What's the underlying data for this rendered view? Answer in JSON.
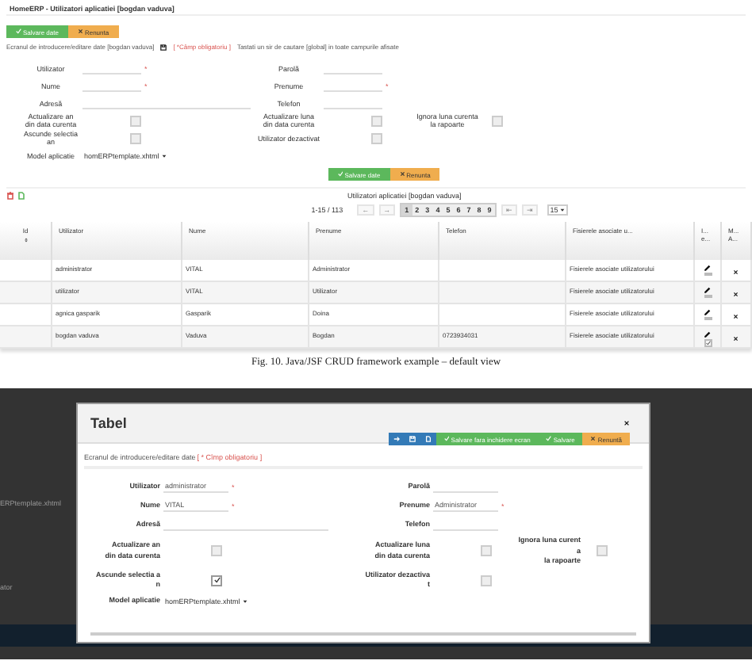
{
  "default_view": {
    "title": "HomeERP - Utilizatori aplicatiei [bogdan vaduva]",
    "top_buttons": [
      {
        "kind": "save",
        "label": "Salvare date"
      },
      {
        "kind": "cancel",
        "label": "Renunta"
      }
    ],
    "form_note": {
      "text": "Ecranul de introducere/editare date [bogdan vaduva]",
      "required_note": "[ *Câmp obligatoriu ]",
      "search_hint": "Tastati un sir de cautare [global] in toate campurile afisate"
    },
    "form_rows": [
      {
        "left": {
          "kind": "text",
          "label": [
            "Utilizator"
          ],
          "mark": "*"
        },
        "middle": {
          "kind": "text",
          "label": [
            "Parolă"
          ]
        }
      },
      {
        "left": {
          "kind": "text",
          "label": [
            "Nume"
          ],
          "mark": "*"
        },
        "middle": {
          "kind": "text",
          "label": [
            "Prenume"
          ],
          "mark": "*"
        }
      },
      {
        "left": {
          "kind": "wide",
          "label": [
            "Adresă"
          ]
        },
        "middle": {
          "kind": "text",
          "label": [
            "Telefon"
          ]
        }
      },
      {
        "left": {
          "kind": "check",
          "label": [
            "Actualizare an",
            "din data curenta"
          ],
          "checked": false
        },
        "middle": {
          "kind": "check",
          "label": [
            "Actualizare luna",
            "din data curenta"
          ],
          "checked": false
        },
        "right": {
          "kind": "check",
          "label": [
            "Ignora luna curenta",
            "la rapoarte"
          ],
          "checked": false
        }
      },
      {
        "left": {
          "kind": "check",
          "label": [
            "Ascunde selectia an"
          ],
          "checked": false
        },
        "middle": {
          "kind": "check",
          "label": [
            "Utilizator dezactivat"
          ],
          "checked": false
        }
      },
      {
        "left": {
          "kind": "select",
          "label": [
            "Model aplicatie"
          ],
          "value": "homERPtemplate.xhtml"
        }
      }
    ],
    "bottom_buttons": [
      {
        "kind": "save",
        "label": "Salvare date"
      },
      {
        "kind": "cancel",
        "label": "Renunta"
      }
    ],
    "table_title": "Utilizatori aplicatiei [bogdan vaduva]",
    "pager": {
      "range": "1-15 / 113",
      "prev": [
        "←",
        "→"
      ],
      "next": [
        "⇤",
        "⇥"
      ],
      "page_size": "15",
      "pages": [
        {
          "label": "1",
          "selected": true
        },
        {
          "label": "2",
          "selected": false
        },
        {
          "label": "3",
          "selected": false
        },
        {
          "label": "4",
          "selected": false
        },
        {
          "label": "5",
          "selected": false
        },
        {
          "label": "6",
          "selected": false
        },
        {
          "label": "7",
          "selected": false
        },
        {
          "label": "8",
          "selected": false
        },
        {
          "label": "9",
          "selected": false
        }
      ]
    },
    "columns": [
      {
        "label": [
          "Id"
        ],
        "sortable": true
      },
      {
        "label": [
          "Utilizator"
        ]
      },
      {
        "label": [
          "Nume"
        ]
      },
      {
        "label": [
          "Prenume"
        ]
      },
      {
        "label": [
          "Telefon"
        ]
      },
      {
        "label": [
          "Fisierele asociate u..."
        ]
      },
      {
        "label": [
          "I...",
          "e..."
        ]
      },
      {
        "label": [
          "M...",
          "A..."
        ]
      }
    ],
    "rows": [
      {
        "utilizator": "administrator",
        "nume": "VITAL",
        "prenume": "Administrator",
        "fisiere": "Fisierele asociate utilizatorului",
        "flag_checked": false
      },
      {
        "utilizator": "utilizator",
        "nume": "VITAL",
        "prenume": "Utilizator",
        "fisiere": "Fisierele asociate utilizatorului",
        "flag_checked": false
      },
      {
        "utilizator": "agnica gasparik",
        "nume": "Gasparik",
        "prenume": "Doina",
        "fisiere": "Fisierele asociate utilizatorului",
        "flag_checked": false
      },
      {
        "utilizator": "bogdan vaduva",
        "nume": "Vaduva",
        "prenume": "Bogdan",
        "telefon": "0723934031",
        "fisiere": "Fisierele asociate utilizatorului",
        "flag_checked": true
      }
    ]
  },
  "caption": "Fig. 10. Java/JSF CRUD framework example – default view",
  "modal_view": {
    "background": {
      "model_value": "ERPtemplate.xhtml",
      "label_fragment": "ator"
    },
    "title": "Tabel",
    "toolbar": [
      {
        "kind": "nav"
      },
      {
        "kind": "save",
        "label": "Salvare fara inchidere ecran"
      },
      {
        "kind": "save",
        "label": "Salvare"
      },
      {
        "kind": "cancel",
        "label": "Renuntă"
      }
    ],
    "form_note": {
      "text": "Ecranul de introducere/editare date",
      "required_note": "[ * Cîmp obligatoriu ]"
    },
    "form_rows": [
      {
        "left": {
          "kind": "text",
          "label": [
            "Utilizator"
          ],
          "value": "administrator",
          "mark": "*"
        },
        "middle": {
          "kind": "text",
          "label": [
            "Parolă"
          ]
        }
      },
      {
        "left": {
          "kind": "text",
          "label": [
            "Nume"
          ],
          "value": "VITAL",
          "mark": "*"
        },
        "middle": {
          "kind": "text",
          "label": [
            "Prenume"
          ],
          "value": "Administrator",
          "mark": "*"
        }
      },
      {
        "left": {
          "kind": "wide",
          "label": [
            "Adresă"
          ]
        },
        "middle": {
          "kind": "text",
          "label": [
            "Telefon"
          ]
        }
      },
      {
        "left": {
          "kind": "check",
          "label": [
            "Actualizare an",
            "din data curenta"
          ],
          "checked": false
        },
        "middle": {
          "kind": "check",
          "label": [
            "Actualizare luna",
            "din data curenta"
          ],
          "checked": false
        },
        "right": {
          "kind": "check",
          "label": [
            "Ignora luna curent",
            "a",
            "la rapoarte"
          ],
          "checked": false
        }
      },
      {
        "left": {
          "kind": "check",
          "label": [
            "Ascunde selectia a",
            "n"
          ],
          "checked": true
        },
        "middle": {
          "kind": "check",
          "label": [
            "Utilizator dezactiva",
            "t"
          ],
          "checked": false
        }
      },
      {
        "left": {
          "kind": "select",
          "label": [
            "Model aplicatie"
          ],
          "value": "homERPtemplate.xhtml"
        }
      }
    ]
  }
}
